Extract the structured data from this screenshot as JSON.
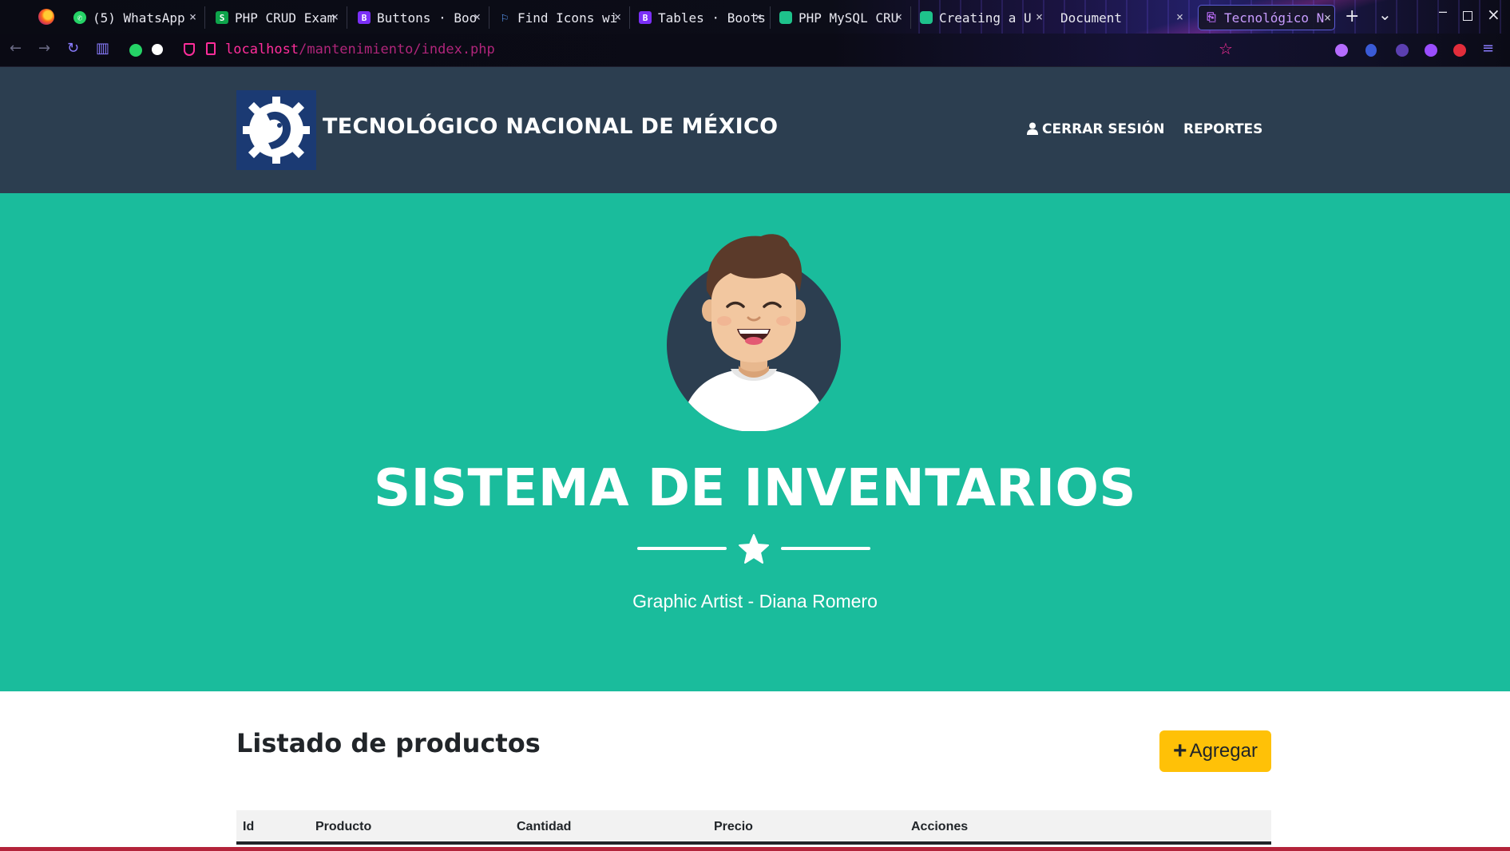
{
  "browser": {
    "tabs": [
      {
        "label": "(5) WhatsApp",
        "icon": "whatsapp-icon",
        "color": "#25d366"
      },
      {
        "label": "PHP CRUD Exam",
        "icon": "s-logo-icon",
        "color": "#0ea44b"
      },
      {
        "label": "Buttons · Boo",
        "icon": "bootstrap-icon",
        "color": "#7b2ff7"
      },
      {
        "label": "Find Icons wi",
        "icon": "flag-icon",
        "color": "#5ea0ff"
      },
      {
        "label": "Tables · Boots",
        "icon": "bootstrap-icon",
        "color": "#7b2ff7"
      },
      {
        "label": "PHP MySQL CRU",
        "icon": "cube-icon",
        "color": "#1ec28b"
      },
      {
        "label": "Creating a U",
        "icon": "cube-icon",
        "color": "#1ec28b"
      },
      {
        "label": "Document",
        "icon": "",
        "color": ""
      },
      {
        "label": "Tecnológico N",
        "icon": "page-icon",
        "color": "#c070ff"
      }
    ],
    "url_host": "localhost",
    "url_path": "/mantenimiento/index.php"
  },
  "header": {
    "brand": "TECNOLÓGICO NACIONAL DE MÉXICO",
    "nav": [
      {
        "label": "CERRAR SESIÓN",
        "icon": "user-icon"
      },
      {
        "label": "REPORTES"
      }
    ]
  },
  "masthead": {
    "title": "SISTEMA DE INVENTARIOS",
    "subtitle": "Graphic Artist - Diana Romero",
    "divider_icon": "star-icon"
  },
  "content": {
    "section_title": "Listado de productos",
    "add_button_label": "Agregar",
    "table_headers": [
      "Id",
      "Producto",
      "Cantidad",
      "Precio",
      "Acciones"
    ]
  },
  "colors": {
    "header_bg": "#2c3e50",
    "masthead_bg": "#1abc9c",
    "button_bg": "#ffc107",
    "url_accent": "#ff2d9a"
  }
}
